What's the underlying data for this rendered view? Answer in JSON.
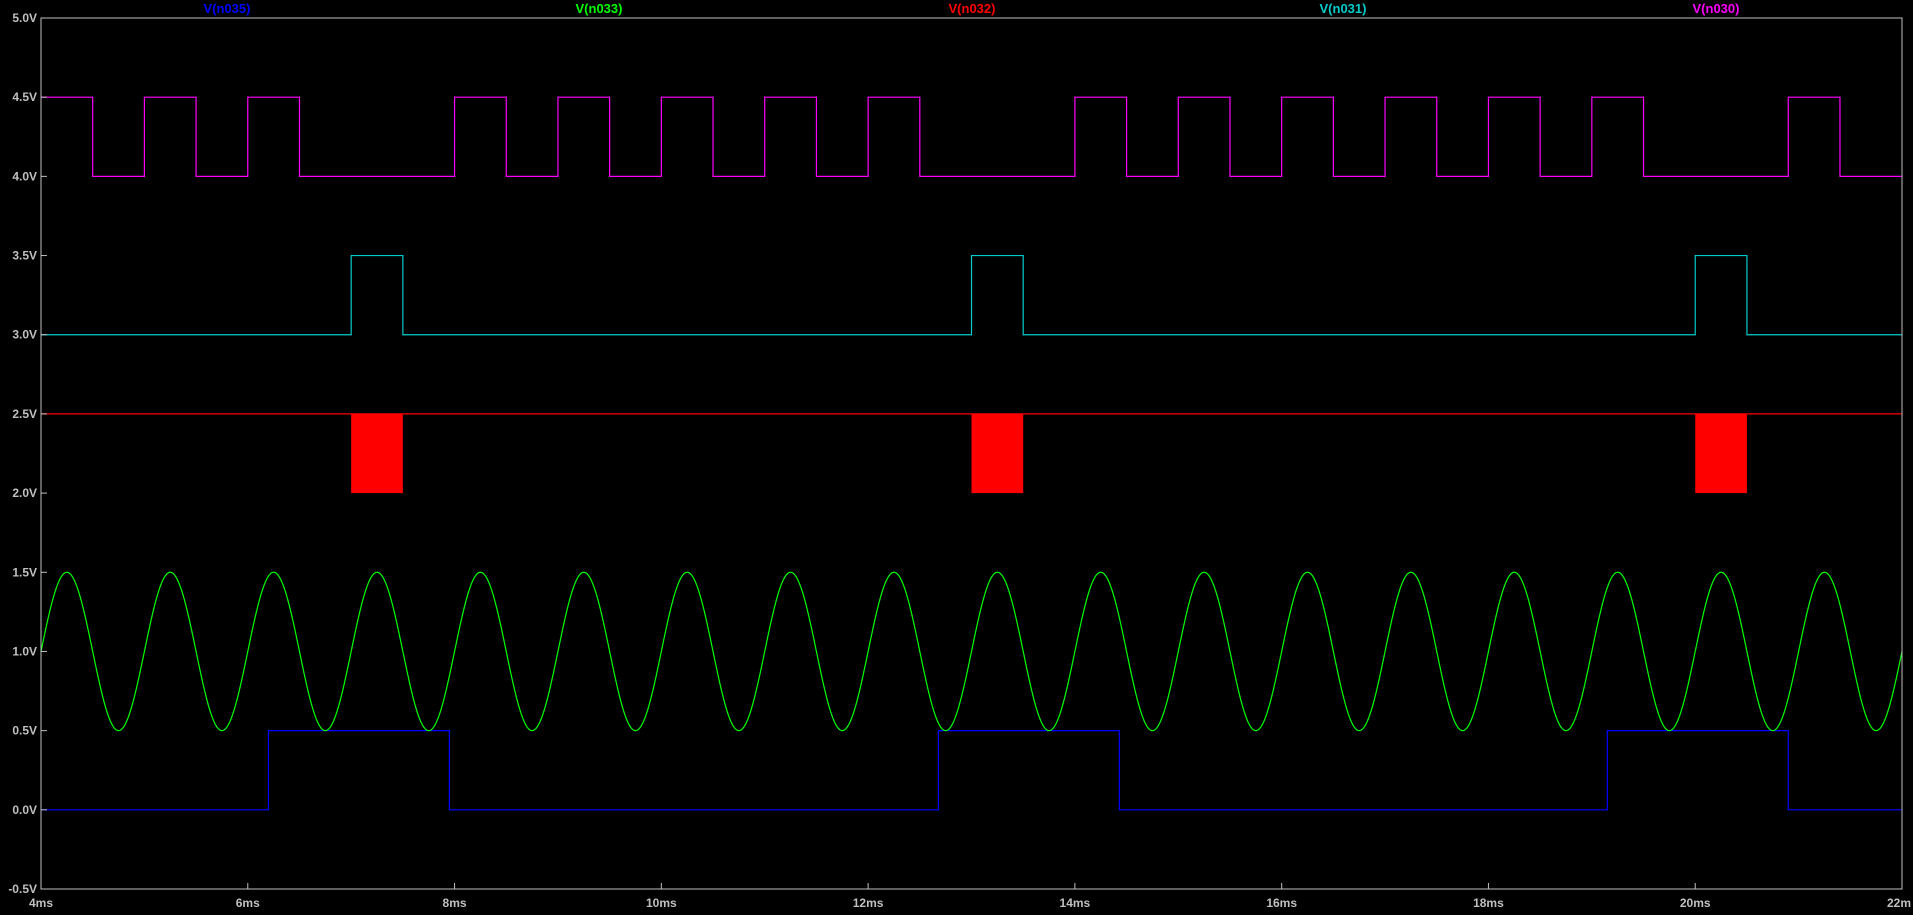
{
  "chart_data": {
    "type": "line",
    "title": "",
    "xlabel": "",
    "ylabel": "",
    "xlim": [
      4,
      22
    ],
    "ylim": [
      -0.5,
      5.0
    ],
    "x_unit": "ms",
    "y_unit": "V",
    "x_ticks": [
      "4ms",
      "6ms",
      "8ms",
      "10ms",
      "12ms",
      "14ms",
      "16ms",
      "18ms",
      "20ms",
      "22m"
    ],
    "y_ticks": [
      "-0.5V",
      "0.0V",
      "0.5V",
      "1.0V",
      "1.5V",
      "2.0V",
      "2.5V",
      "3.0V",
      "3.5V",
      "4.0V",
      "4.5V",
      "5.0V"
    ],
    "grid": false,
    "legend_position": "top",
    "series": [
      {
        "name": "V(n035)",
        "color": "#0000ff",
        "kind": "step",
        "points": [
          [
            4,
            0
          ],
          [
            6.2,
            0
          ],
          [
            6.2,
            0.5
          ],
          [
            7.95,
            0.5
          ],
          [
            7.95,
            0
          ],
          [
            12.68,
            0
          ],
          [
            12.68,
            0.5
          ],
          [
            14.43,
            0.5
          ],
          [
            14.43,
            0
          ],
          [
            19.15,
            0
          ],
          [
            19.15,
            0.5
          ],
          [
            20.9,
            0.5
          ],
          [
            20.9,
            0
          ],
          [
            22,
            0
          ]
        ]
      },
      {
        "name": "V(n033)",
        "color": "#00ff00",
        "kind": "sine",
        "offset": 1.0,
        "amplitude": 0.5,
        "frequency_khz": 1.0,
        "start": 4,
        "end": 22
      },
      {
        "name": "V(n032)",
        "color": "#ff0000",
        "kind": "step_with_bursts",
        "baseline": 2.5,
        "burst_low": 2.0,
        "bursts": [
          [
            7.0,
            7.5
          ],
          [
            13.0,
            13.5
          ],
          [
            20.0,
            20.5
          ]
        ]
      },
      {
        "name": "V(n031)",
        "color": "#00cccc",
        "kind": "step",
        "points": [
          [
            4,
            3.0
          ],
          [
            7.0,
            3.0
          ],
          [
            7.0,
            3.5
          ],
          [
            7.5,
            3.5
          ],
          [
            7.5,
            3.0
          ],
          [
            13.0,
            3.0
          ],
          [
            13.0,
            3.5
          ],
          [
            13.5,
            3.5
          ],
          [
            13.5,
            3.0
          ],
          [
            20.0,
            3.0
          ],
          [
            20.0,
            3.5
          ],
          [
            20.5,
            3.5
          ],
          [
            20.5,
            3.0
          ],
          [
            22,
            3.0
          ]
        ]
      },
      {
        "name": "V(n030)",
        "color": "#ff00ff",
        "kind": "step",
        "points": [
          [
            4,
            4.5
          ],
          [
            4.5,
            4.5
          ],
          [
            4.5,
            4.0
          ],
          [
            5.0,
            4.0
          ],
          [
            5.0,
            4.5
          ],
          [
            5.5,
            4.5
          ],
          [
            5.5,
            4.0
          ],
          [
            6.0,
            4.0
          ],
          [
            6.0,
            4.5
          ],
          [
            6.5,
            4.5
          ],
          [
            6.5,
            4.0
          ],
          [
            8.0,
            4.0
          ],
          [
            8.0,
            4.5
          ],
          [
            8.5,
            4.5
          ],
          [
            8.5,
            4.0
          ],
          [
            9.0,
            4.0
          ],
          [
            9.0,
            4.5
          ],
          [
            9.5,
            4.5
          ],
          [
            9.5,
            4.0
          ],
          [
            10.0,
            4.0
          ],
          [
            10.0,
            4.5
          ],
          [
            10.5,
            4.5
          ],
          [
            10.5,
            4.0
          ],
          [
            11.0,
            4.0
          ],
          [
            11.0,
            4.5
          ],
          [
            11.5,
            4.5
          ],
          [
            11.5,
            4.0
          ],
          [
            12.0,
            4.0
          ],
          [
            12.0,
            4.5
          ],
          [
            12.5,
            4.5
          ],
          [
            12.5,
            4.0
          ],
          [
            14.0,
            4.0
          ],
          [
            14.0,
            4.5
          ],
          [
            14.5,
            4.5
          ],
          [
            14.5,
            4.0
          ],
          [
            15.0,
            4.0
          ],
          [
            15.0,
            4.5
          ],
          [
            15.5,
            4.5
          ],
          [
            15.5,
            4.0
          ],
          [
            16.0,
            4.0
          ],
          [
            16.0,
            4.5
          ],
          [
            16.5,
            4.5
          ],
          [
            16.5,
            4.0
          ],
          [
            17.0,
            4.0
          ],
          [
            17.0,
            4.5
          ],
          [
            17.5,
            4.5
          ],
          [
            17.5,
            4.0
          ],
          [
            18.0,
            4.0
          ],
          [
            18.0,
            4.5
          ],
          [
            18.5,
            4.5
          ],
          [
            18.5,
            4.0
          ],
          [
            19.0,
            4.0
          ],
          [
            19.0,
            4.5
          ],
          [
            19.5,
            4.5
          ],
          [
            19.5,
            4.0
          ],
          [
            20.9,
            4.0
          ],
          [
            20.9,
            4.5
          ],
          [
            21.4,
            4.5
          ],
          [
            21.4,
            4.0
          ],
          [
            22,
            4.0
          ]
        ]
      }
    ]
  }
}
